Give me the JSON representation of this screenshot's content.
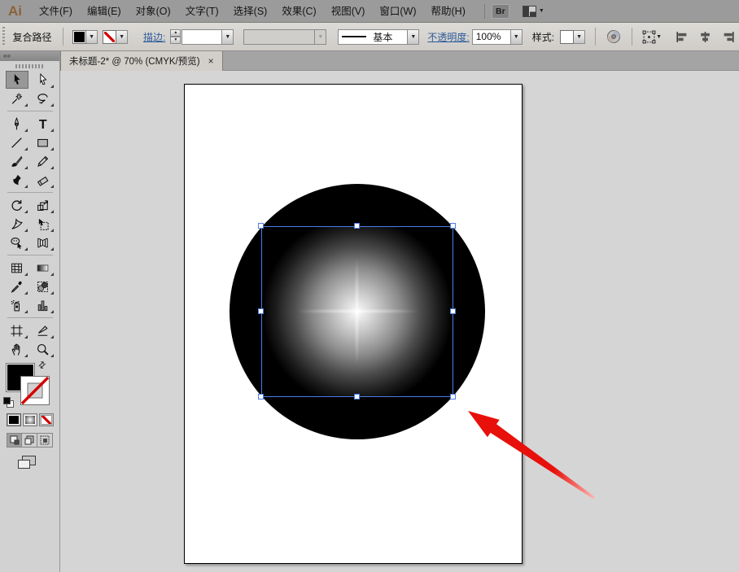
{
  "colors": {
    "menu_bar_bg": "#9b9b9b",
    "control_bar_bg": "#d6d3cf",
    "panel_bg": "#d2d2d2",
    "tab_bar_bg": "#a4a4a4",
    "tab_active_bg": "#d2cfca",
    "pasteboard_bg": "#d5d5d5",
    "artboard_bg": "#ffffff",
    "selection_blue": "#4a7ce8",
    "link_blue": "#2d5b9a",
    "arrow_red": "#e8100a",
    "logo_brown": "#8c6239",
    "circle_fill": "#000000"
  },
  "icons": {
    "dropdown": "▼",
    "spinner_up": "▲",
    "spinner_down": "▼",
    "swap": "⇄",
    "collapse": "« «"
  },
  "menu_bar": {
    "logo": "Ai",
    "items": [
      {
        "id": "file",
        "label": "文件(F)"
      },
      {
        "id": "edit",
        "label": "编辑(E)"
      },
      {
        "id": "object",
        "label": "对象(O)"
      },
      {
        "id": "type",
        "label": "文字(T)"
      },
      {
        "id": "select",
        "label": "选择(S)"
      },
      {
        "id": "effect",
        "label": "效果(C)"
      },
      {
        "id": "view",
        "label": "视图(V)"
      },
      {
        "id": "window",
        "label": "窗口(W)"
      },
      {
        "id": "help",
        "label": "帮助(H)"
      }
    ],
    "bridge_button": "Br"
  },
  "control_bar": {
    "context_label": "复合路径",
    "stroke_link": "描边:",
    "stroke_weight_value": "",
    "variable_width_value": "",
    "brush_value": "基本",
    "opacity_link": "不透明度:",
    "opacity_value": "100%",
    "style_label": "样式:"
  },
  "document_tab": {
    "title": "未标题-2* @ 70% (CMYK/预览)",
    "close_label": "×"
  },
  "toolbox": {
    "selected_tool": "selection",
    "groups": [
      [
        "selection",
        "direct-selection",
        "magic-wand",
        "lasso"
      ],
      [
        "pen",
        "type",
        "line-segment",
        "rectangle",
        "paintbrush",
        "pencil",
        "blob-brush",
        "eraser"
      ],
      [
        "rotate",
        "scale",
        "width",
        "free-transform",
        "shape-builder",
        "perspective-grid"
      ],
      [
        "mesh",
        "gradient",
        "eyedropper",
        "blend",
        "symbol-sprayer",
        "column-graph"
      ],
      [
        "artboard",
        "slice",
        "hand",
        "zoom"
      ]
    ]
  }
}
